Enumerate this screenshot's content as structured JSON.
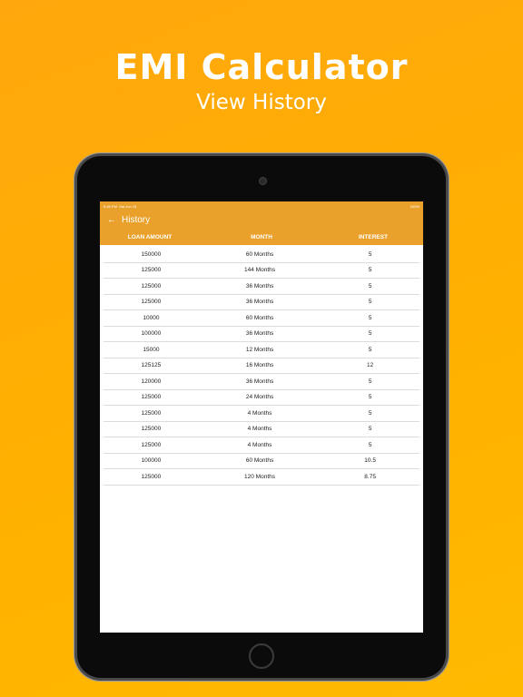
{
  "promo": {
    "title": "EMI Calculator",
    "subtitle": "View History"
  },
  "status_bar": {
    "time": "5:45 PM",
    "date": "Sat Jun 15",
    "battery": "100%"
  },
  "app_bar": {
    "back_icon": "←",
    "title": "History",
    "color": "#E9A12B"
  },
  "table": {
    "headers": [
      "LOAN AMOUNT",
      "MONTH",
      "INTEREST"
    ],
    "rows": [
      [
        "150000",
        "60 Months",
        "5"
      ],
      [
        "125000",
        "144 Months",
        "5"
      ],
      [
        "125000",
        "36 Months",
        "5"
      ],
      [
        "125000",
        "36 Months",
        "5"
      ],
      [
        "10000",
        "60 Months",
        "5"
      ],
      [
        "100000",
        "36 Months",
        "5"
      ],
      [
        "15000",
        "12 Months",
        "5"
      ],
      [
        "125125",
        "16 Months",
        "12"
      ],
      [
        "120000",
        "36 Months",
        "5"
      ],
      [
        "125000",
        "24 Months",
        "5"
      ],
      [
        "125000",
        "4 Months",
        "5"
      ],
      [
        "125000",
        "4 Months",
        "5"
      ],
      [
        "125000",
        "4 Months",
        "5"
      ],
      [
        "100000",
        "60 Months",
        "10.5"
      ],
      [
        "125000",
        "120 Months",
        "8.75"
      ]
    ]
  }
}
